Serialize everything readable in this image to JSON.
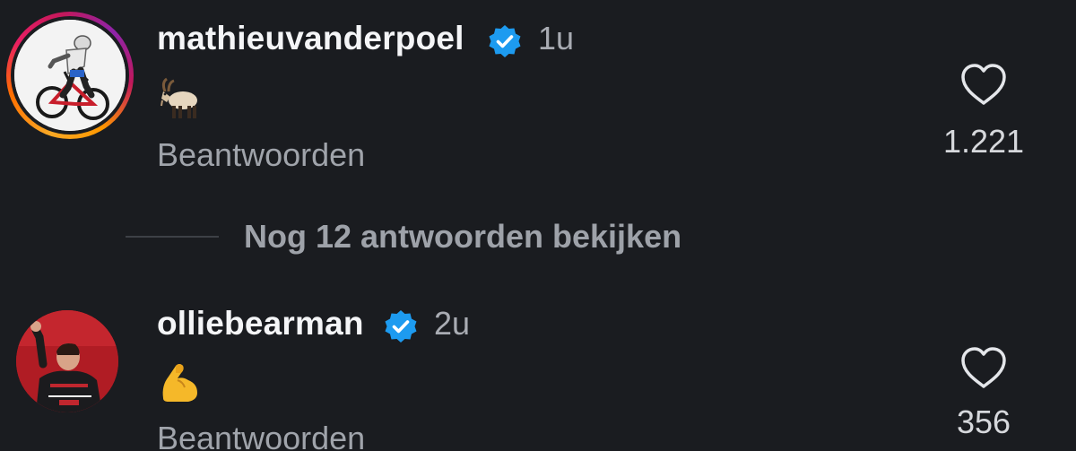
{
  "comments": [
    {
      "username": "mathieuvanderpoel",
      "verified": true,
      "time": "1u",
      "content_emoji": "goat",
      "reply_label": "Beantwoorden",
      "likes": "1.221",
      "has_story_ring": true
    },
    {
      "username": "olliebearman",
      "verified": true,
      "time": "2u",
      "content_emoji": "flexed-biceps",
      "reply_label": "Beantwoorden",
      "likes": "356",
      "has_story_ring": false
    }
  ],
  "thread": {
    "more_replies_label": "Nog 12 antwoorden bekijken"
  },
  "icons": {
    "verified": "verified-badge-icon",
    "like": "heart-outline-icon"
  },
  "colors": {
    "background": "#1a1c20",
    "verified": "#1d9bf0",
    "secondary_text": "#a0a4ab"
  }
}
